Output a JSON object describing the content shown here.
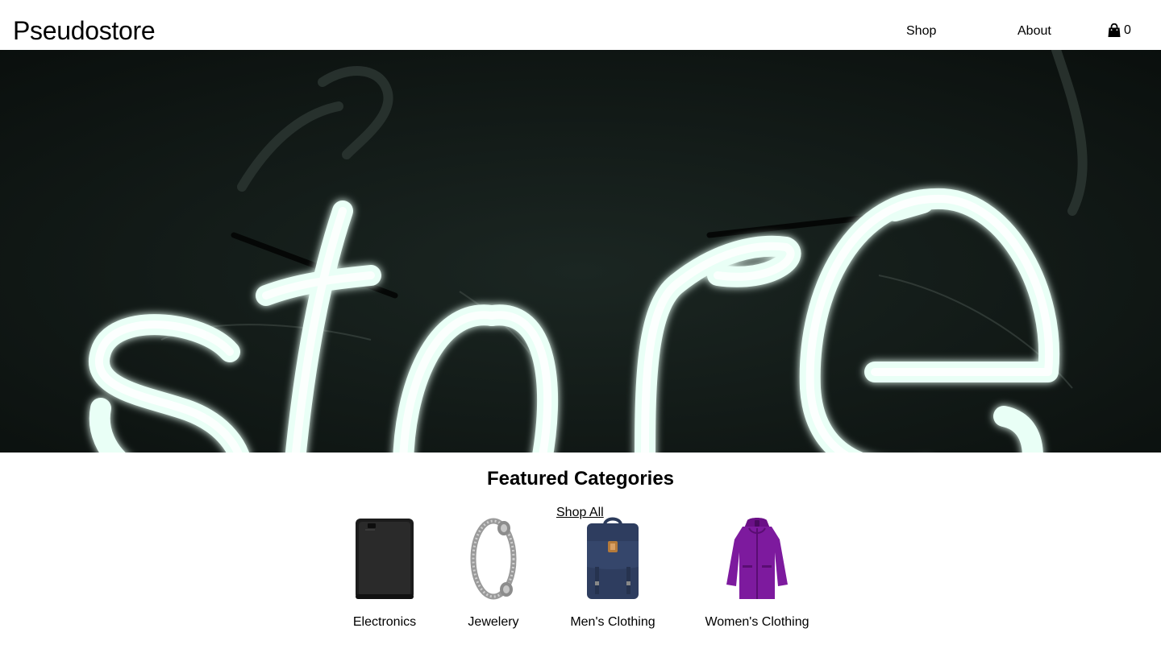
{
  "header": {
    "brand": "Pseudostore",
    "nav": [
      {
        "label": "Shop"
      },
      {
        "label": "About"
      }
    ],
    "cart": {
      "icon": "shopping-bag-icon",
      "count": "0"
    }
  },
  "hero": {
    "image": "neon store sign photo",
    "accent": "#e6fff6",
    "background": "#111816"
  },
  "featured": {
    "title": "Featured Categories",
    "shop_all": "Shop All",
    "categories": [
      {
        "label": "Electronics",
        "image": "external-hard-drive"
      },
      {
        "label": "Jewelery",
        "image": "silver-bracelet"
      },
      {
        "label": "Men's Clothing",
        "image": "navy-backpack"
      },
      {
        "label": "Women's Clothing",
        "image": "purple-jacket"
      }
    ]
  }
}
